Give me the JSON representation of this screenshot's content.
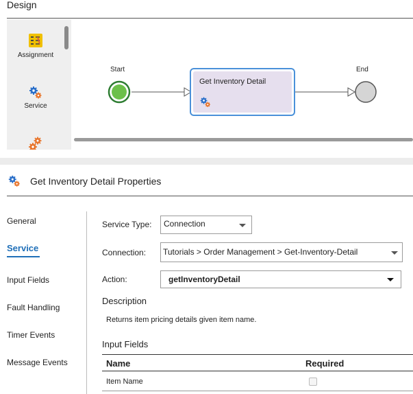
{
  "design": {
    "title": "Design",
    "palette": [
      {
        "label": "Assignment",
        "icon": "assignment-icon"
      },
      {
        "label": "Service",
        "icon": "service-icon"
      },
      {
        "label": "",
        "icon": "gears-icon"
      }
    ],
    "flow": {
      "start_label": "Start",
      "end_label": "End",
      "step_title": "Get Inventory Detail"
    }
  },
  "properties": {
    "title": "Get Inventory Detail Properties",
    "sidebar": [
      "General",
      "Service",
      "Input Fields",
      "Fault Handling",
      "Timer Events",
      "Message Events"
    ],
    "active_tab": "Service",
    "service_type_label": "Service Type:",
    "service_type_value": "Connection",
    "connection_label": "Connection:",
    "connection_value": "Tutorials > Order Management > Get-Inventory-Detail",
    "action_label": "Action:",
    "action_value": "getInventoryDetail",
    "description_title": "Description",
    "description_text": "Returns item pricing details given item name.",
    "input_fields_title": "Input Fields",
    "table": {
      "headers": [
        "Name",
        "Required"
      ],
      "rows": [
        {
          "name": "Item Name",
          "required": false
        }
      ]
    }
  },
  "colors": {
    "accent": "#1f6fb8",
    "start_node": "#5cb85c",
    "step_fill": "#e6dfee",
    "step_border": "#4a90d9"
  }
}
